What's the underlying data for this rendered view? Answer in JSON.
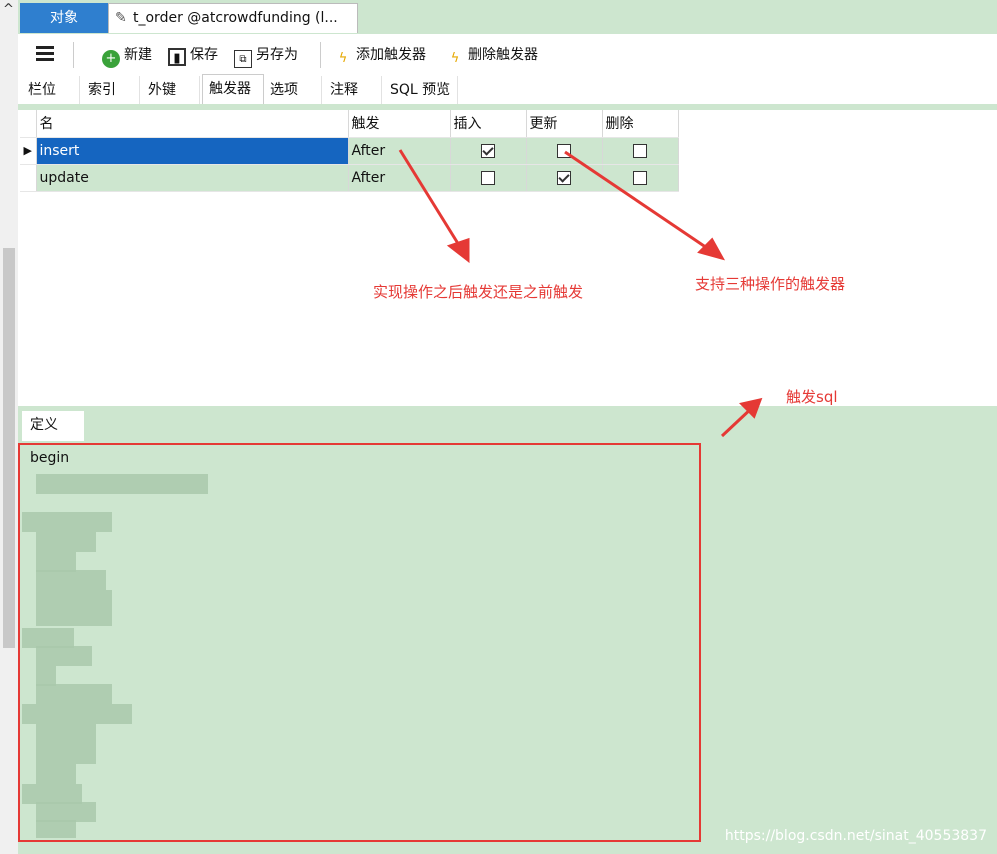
{
  "tabs": {
    "object_label": "对象",
    "document_label": "t_order @atcrowdfunding (l..."
  },
  "toolbar": {
    "new_label": "新建",
    "save_label": "保存",
    "save_as_label": "另存为",
    "add_trigger_label": "添加触发器",
    "delete_trigger_label": "删除触发器"
  },
  "subtabs": [
    "栏位",
    "索引",
    "外键",
    "触发器",
    "选项",
    "注释",
    "SQL 预览"
  ],
  "active_subtab": "触发器",
  "grid": {
    "headers": [
      "名",
      "触发",
      "插入",
      "更新",
      "删除"
    ],
    "rows": [
      {
        "name": "insert",
        "fire": "After",
        "insert": true,
        "update": false,
        "delete": false
      },
      {
        "name": "update",
        "fire": "After",
        "insert": false,
        "update": true,
        "delete": false
      }
    ]
  },
  "definition": {
    "tab_label": "定义",
    "first_line": "begin"
  },
  "annotations": {
    "timing": "实现操作之后触发还是之前触发",
    "three_ops": "支持三种操作的触发器",
    "sql": "触发sql"
  },
  "watermark": "https://blog.csdn.net/sinat_40553837",
  "colors": {
    "panel_green": "#cde6cf",
    "selected_blue": "#1565c0",
    "annotation_red": "#e53935",
    "tab_blue": "#2f7fcf"
  }
}
